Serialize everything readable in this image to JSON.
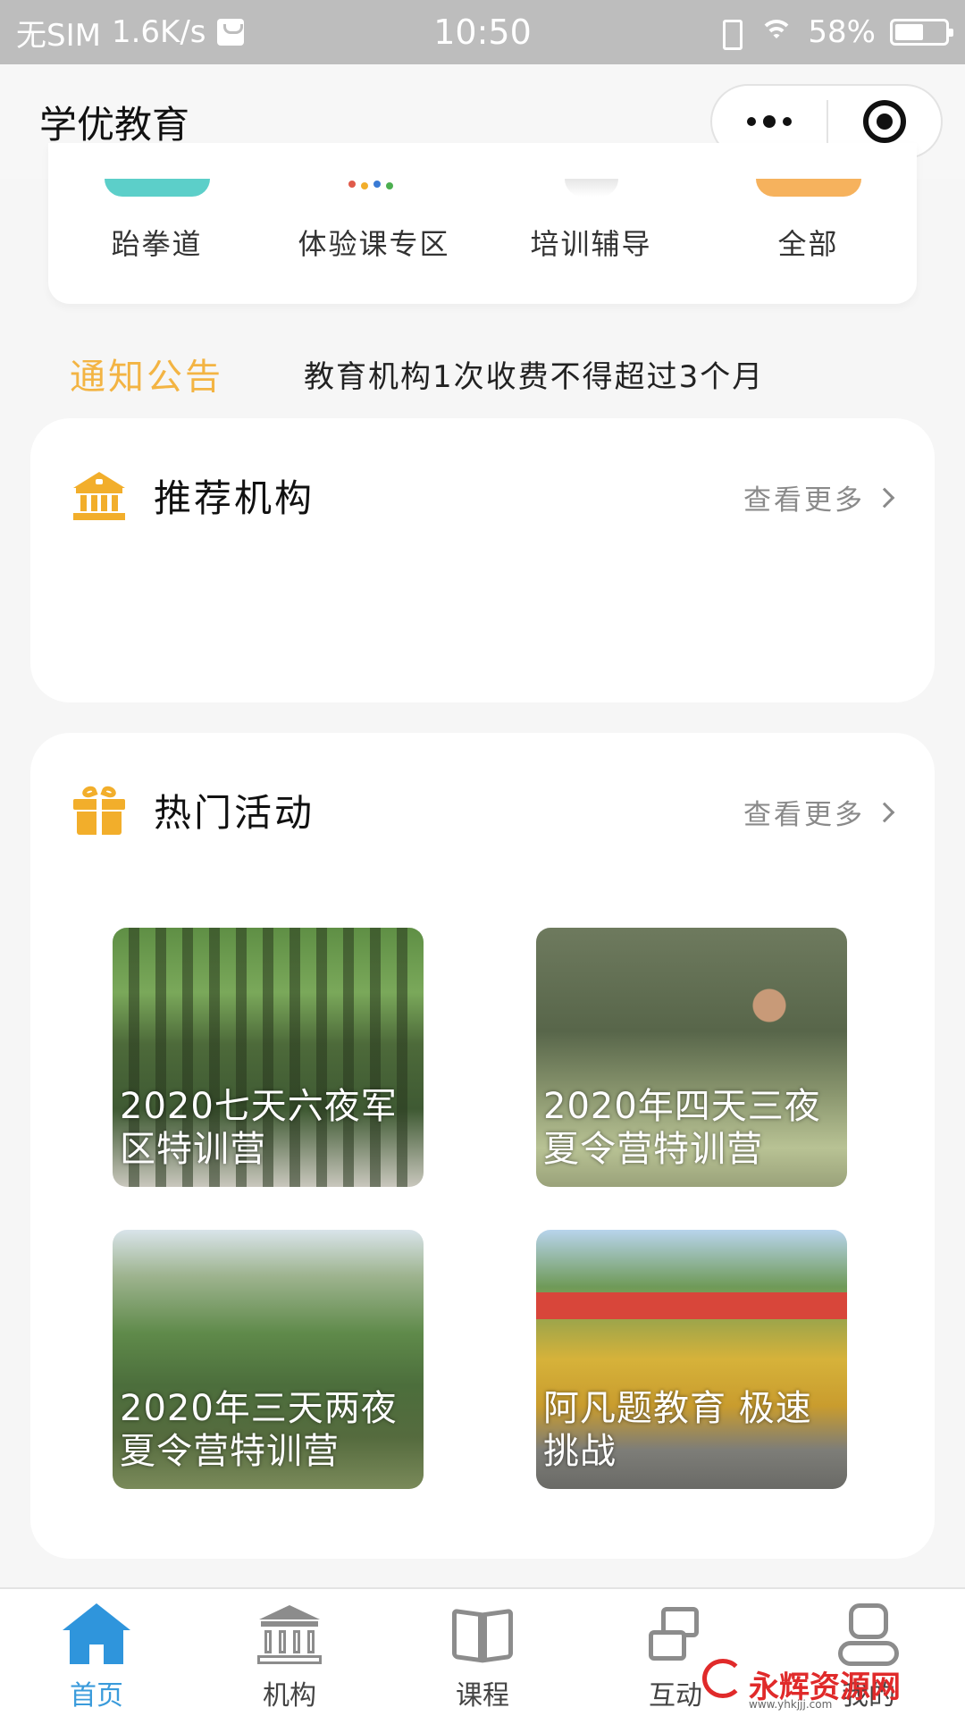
{
  "status_bar": {
    "carrier": "无SIM",
    "speed": "1.6K/s",
    "time": "10:50",
    "battery_text": "58%",
    "battery_level": 0.58
  },
  "nav": {
    "title": "学优教育"
  },
  "categories": [
    {
      "label": "跆拳道",
      "color": "#5ccfc9"
    },
    {
      "label": "体验课专区",
      "color": "#ffffff"
    },
    {
      "label": "培训辅导",
      "color": "#ffffff"
    },
    {
      "label": "全部",
      "color": "#f6b25d"
    }
  ],
  "notice": {
    "label": "通知公告",
    "text": "教育机构1次收费不得超过3个月"
  },
  "recommend": {
    "title": "推荐机构",
    "more": "查看更多",
    "icon": "bank-icon"
  },
  "hot": {
    "title": "热门活动",
    "more": "查看更多",
    "icon": "gift-icon",
    "activities": [
      {
        "title": "2020七天六夜军区特训营"
      },
      {
        "title": "2020年四天三夜夏令营特训营"
      },
      {
        "title": "2020年三天两夜夏令营特训营"
      },
      {
        "title": "阿凡题教育 极速挑战"
      }
    ]
  },
  "tabs": [
    {
      "label": "首页",
      "icon": "home-icon",
      "active": true
    },
    {
      "label": "机构",
      "icon": "institution-icon",
      "active": false
    },
    {
      "label": "课程",
      "icon": "book-icon",
      "active": false
    },
    {
      "label": "互动",
      "icon": "interaction-icon",
      "active": false
    },
    {
      "label": "我的",
      "icon": "user-icon",
      "active": false
    }
  ],
  "watermark": {
    "text": "永辉资源网",
    "url_text": "www.yhkjjj.com"
  },
  "colors": {
    "accent": "#f3b443",
    "tab_active": "#3a9bdb",
    "icon_orange": "#f2ae2b"
  }
}
